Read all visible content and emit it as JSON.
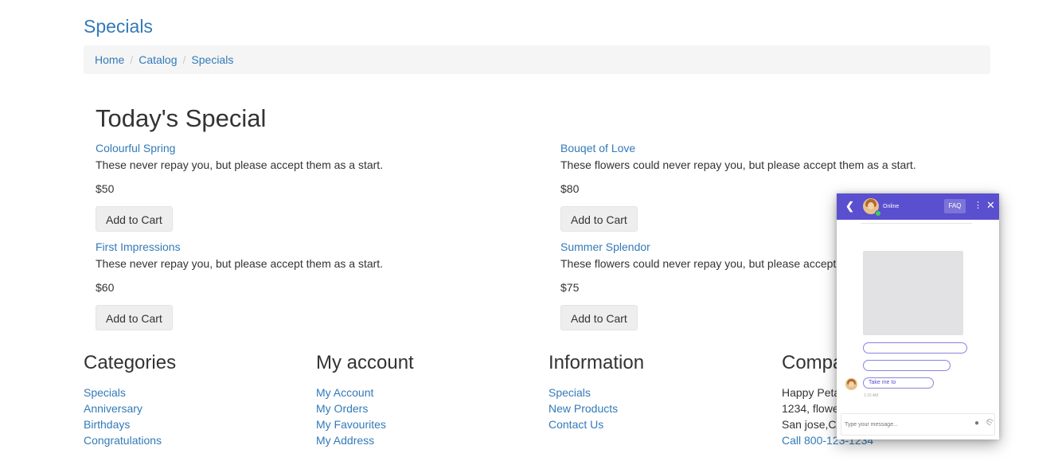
{
  "page": {
    "title": "Specials",
    "breadcrumb": [
      "Home",
      "Catalog",
      "Specials"
    ]
  },
  "specials": {
    "heading": "Today's Special",
    "products": [
      {
        "name": "Colourful Spring",
        "description": "These never repay you, but please accept them as a start.",
        "price": "$50",
        "button": "Add to Cart"
      },
      {
        "name": "Bouqet of Love",
        "description": "These flowers could never repay you, but please accept them as a start.",
        "price": "$80",
        "button": "Add to Cart"
      },
      {
        "name": "First Impressions",
        "description": "These never repay you, but please accept them as a start.",
        "price": "$60",
        "button": "Add to Cart"
      },
      {
        "name": "Summer Splendor",
        "description": "These flowers could never repay you, but please accept them as a start.",
        "price": "$75",
        "button": "Add to Cart"
      }
    ]
  },
  "footer": {
    "categories": {
      "title": "Categories",
      "links": [
        "Specials",
        "Anniversary",
        "Birthdays",
        "Congratulations"
      ]
    },
    "account": {
      "title": "My account",
      "links": [
        "My Account",
        "My Orders",
        "My Favourites",
        "My Address"
      ]
    },
    "information": {
      "title": "Information",
      "links": [
        "Specials",
        "New Products",
        "Contact Us"
      ]
    },
    "company": {
      "title": "Company",
      "lines": [
        "Happy Petals",
        "1234, flowers street",
        "San jose,CA"
      ],
      "phone": "Call 800-123-1234"
    }
  },
  "chat": {
    "status": "Online",
    "faq_label": "FAQ",
    "back_icon": "chevron-left-icon",
    "more_icon": "vertical-dots-icon",
    "close_icon": "close-icon",
    "quick_reply": "Take me to",
    "time": "1:15 AM",
    "input_placeholder": "Type your message...",
    "accent_color": "#5a4fcf"
  }
}
